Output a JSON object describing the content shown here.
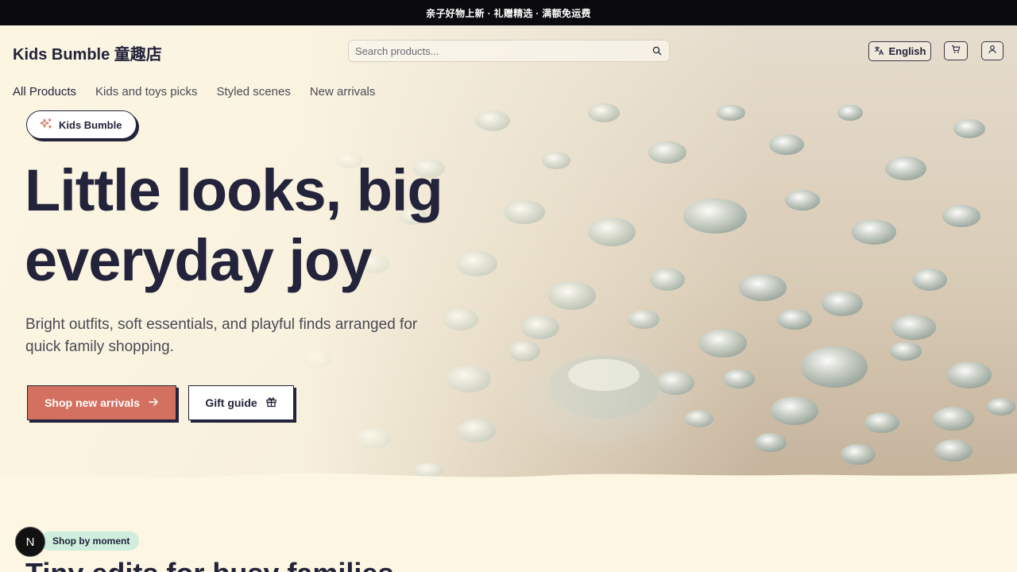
{
  "announcement": "亲子好物上新 · 礼赠精选 · 满额免运费",
  "header": {
    "brand": "Kids Bumble 童趣店",
    "search_placeholder": "Search products...",
    "language_label": "English"
  },
  "nav": {
    "items": [
      {
        "label": "All Products"
      },
      {
        "label": "Kids and toys picks"
      },
      {
        "label": "Styled scenes"
      },
      {
        "label": "New arrivals"
      }
    ]
  },
  "hero": {
    "badge": "Kids Bumble",
    "headline": "Little looks, big everyday joy",
    "subtitle": "Bright outfits, soft essentials, and playful finds arranged for quick family shopping.",
    "primary_cta": "Shop new arrivals",
    "secondary_cta": "Gift guide"
  },
  "section": {
    "chip": "Shop by moment",
    "title": "Tiny edits for busy families"
  },
  "dev_badge": "N",
  "colors": {
    "announce_bg": "#0b0b0f",
    "page_bg": "#fcf6e3",
    "ink": "#23233b",
    "primary": "#d4705f",
    "chip": "#cfeedd"
  },
  "icons": [
    "sparkles-icon",
    "search-icon",
    "translate-icon",
    "cart-icon",
    "user-icon",
    "arrow-right-icon",
    "gift-icon"
  ]
}
